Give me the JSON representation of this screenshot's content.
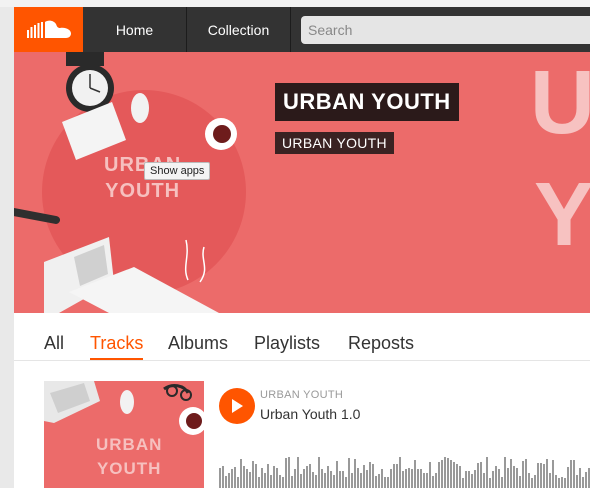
{
  "header": {
    "nav": [
      {
        "label": "Home"
      },
      {
        "label": "Collection"
      }
    ],
    "search": {
      "placeholder": "Search"
    },
    "logo_icon": "soundcloud-cloud-icon",
    "accent_color": "#ff5500"
  },
  "banner": {
    "title": "URBAN YOUTH",
    "subtitle": "URBAN YOUTH",
    "art_text_line1": "URBAN",
    "art_text_line2": "YOUTH",
    "tooltip": "Show apps",
    "big_letters": [
      "U",
      "Y"
    ],
    "background_color": "#ec6b6a"
  },
  "tabs": [
    {
      "label": "All",
      "active": false
    },
    {
      "label": "Tracks",
      "active": true
    },
    {
      "label": "Albums",
      "active": false
    },
    {
      "label": "Playlists",
      "active": false
    },
    {
      "label": "Reposts",
      "active": false
    }
  ],
  "track": {
    "artist": "URBAN YOUTH",
    "title": "Urban Youth 1.0",
    "art_text_line1": "URBAN",
    "art_text_line2": "YOUTH",
    "play_icon": "play-icon"
  }
}
